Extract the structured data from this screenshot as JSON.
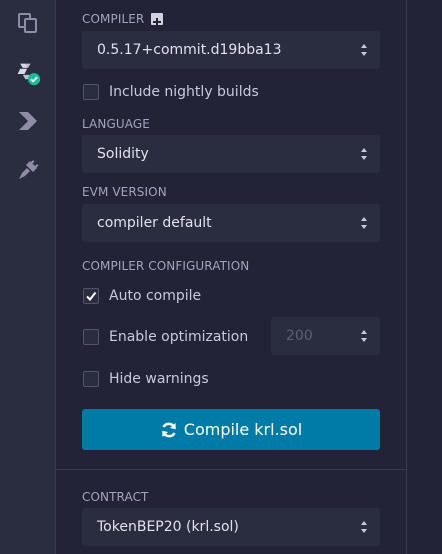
{
  "sidebar": {
    "icons": [
      "file-explorer-icon",
      "solidity-compiler-icon",
      "deploy-run-icon",
      "plugin-manager-icon"
    ],
    "active": "solidity-compiler-icon",
    "badge_color": "#1bbc9b"
  },
  "compiler": {
    "label": "COMPILER",
    "version": "0.5.17+commit.d19bba13",
    "nightly_label": "Include nightly builds",
    "nightly_checked": false
  },
  "language": {
    "label": "LANGUAGE",
    "value": "Solidity"
  },
  "evm": {
    "label": "EVM VERSION",
    "value": "compiler default"
  },
  "config": {
    "label": "COMPILER CONFIGURATION",
    "auto_compile_label": "Auto compile",
    "auto_compile_checked": true,
    "optimization_label": "Enable optimization",
    "optimization_checked": false,
    "runs_value": "200",
    "hide_warnings_label": "Hide warnings",
    "hide_warnings_checked": false
  },
  "compile_button": {
    "label": "Compile krl.sol",
    "color": "#007aa6"
  },
  "contract": {
    "label": "CONTRACT",
    "value": "TokenBEP20 (krl.sol)"
  }
}
